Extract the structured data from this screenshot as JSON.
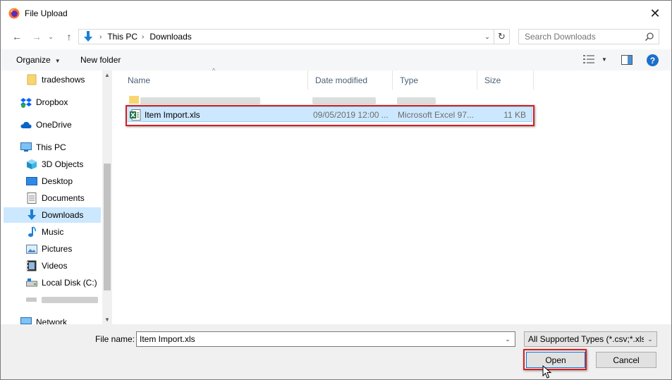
{
  "window": {
    "title": "File Upload",
    "app_icon": "firefox-icon",
    "close_glyph": "✕"
  },
  "navigation": {
    "back_glyph": "←",
    "forward_glyph": "→",
    "recent_glyph": "⌄",
    "up_glyph": "↑",
    "breadcrumbs": [
      "This PC",
      "Downloads"
    ],
    "refresh_glyph": "↻",
    "search_placeholder": "Search Downloads"
  },
  "toolbar": {
    "organize_label": "Organize",
    "new_folder_label": "New folder"
  },
  "sidebar": {
    "items": [
      {
        "label": "tradeshows",
        "icon": "folder-icon"
      },
      {
        "label": "Dropbox",
        "icon": "dropbox-icon"
      },
      {
        "label": "OneDrive",
        "icon": "onedrive-icon"
      },
      {
        "label": "This PC",
        "icon": "computer-icon"
      },
      {
        "label": "3D Objects",
        "icon": "cube-icon"
      },
      {
        "label": "Desktop",
        "icon": "desktop-icon"
      },
      {
        "label": "Documents",
        "icon": "documents-icon"
      },
      {
        "label": "Downloads",
        "icon": "download-icon",
        "selected": true
      },
      {
        "label": "Music",
        "icon": "music-icon"
      },
      {
        "label": "Pictures",
        "icon": "pictures-icon"
      },
      {
        "label": "Videos",
        "icon": "videos-icon"
      },
      {
        "label": "Local Disk (C:)",
        "icon": "disk-icon"
      },
      {
        "label": "",
        "icon": "network-drive-icon",
        "blurred": true
      },
      {
        "label": "Network",
        "icon": "network-icon"
      }
    ]
  },
  "file_list": {
    "columns": [
      "Name",
      "Date modified",
      "Type",
      "Size"
    ],
    "rows": [
      {
        "name": "",
        "date": "",
        "type": "",
        "size": "",
        "blurred": true,
        "icon": "folder-icon"
      },
      {
        "name": "Item Import.xls",
        "date": "09/05/2019 12:00 ...",
        "type": "Microsoft Excel 97...",
        "size": "11 KB",
        "selected": true,
        "icon": "excel-file-icon"
      }
    ]
  },
  "footer": {
    "file_name_label": "File name:",
    "file_name_value": "Item Import.xls",
    "file_type_value": "All Supported Types (*.csv;*.xls;",
    "open_label": "Open",
    "cancel_label": "Cancel"
  },
  "colors": {
    "selection_bg": "#cce8ff",
    "annotation_red": "#d81e1e",
    "help_blue": "#1c6fc9"
  }
}
